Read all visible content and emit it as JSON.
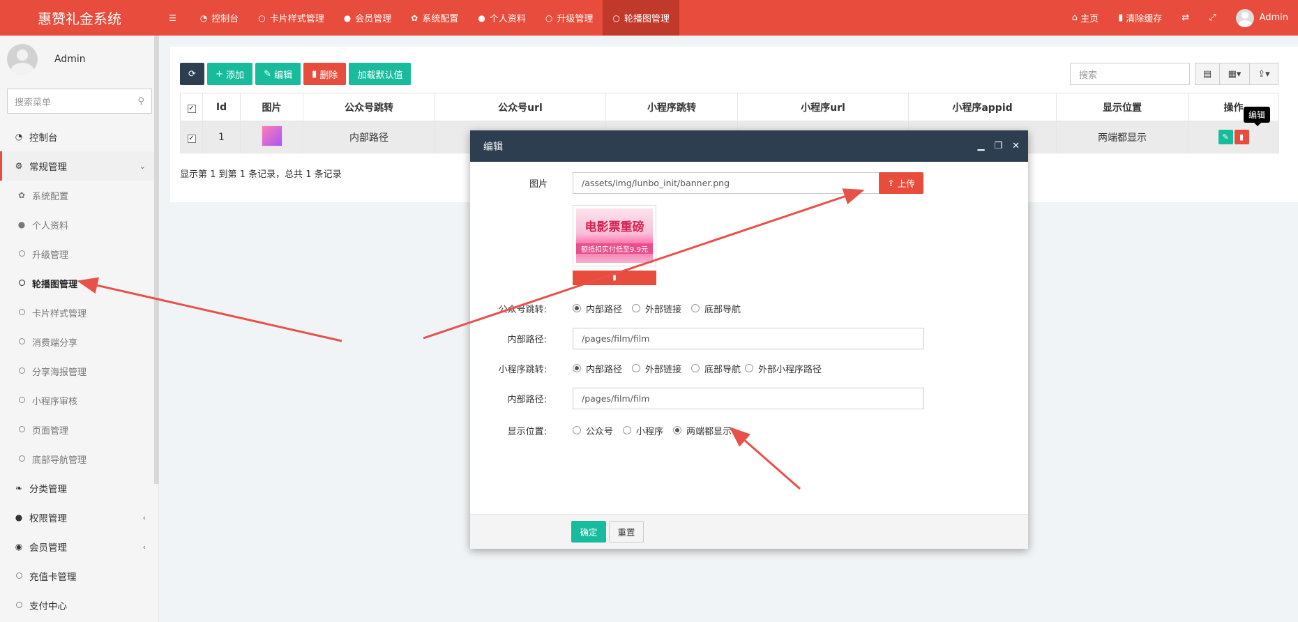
{
  "app": {
    "title": "惠赞礼金系统"
  },
  "topnav": {
    "items": [
      {
        "label": "",
        "icon": "menu-icon"
      },
      {
        "label": "控制台",
        "icon": "dashboard-icon"
      },
      {
        "label": "卡片样式管理",
        "icon": "circle-icon"
      },
      {
        "label": "会员管理",
        "icon": "user-icon"
      },
      {
        "label": "系统配置",
        "icon": "gear-icon"
      },
      {
        "label": "个人资料",
        "icon": "user-icon"
      },
      {
        "label": "升级管理",
        "icon": "circle-icon"
      },
      {
        "label": "轮播图管理",
        "icon": "circle-icon",
        "active": true
      }
    ],
    "right": {
      "home": "主页",
      "clear_cache": "清除缓存",
      "user": "Admin"
    }
  },
  "sidebar": {
    "user": "Admin",
    "search_placeholder": "搜索菜单",
    "items": [
      {
        "label": "控制台",
        "icon": "dashboard-icon",
        "level": 0
      },
      {
        "label": "常规管理",
        "icon": "cogs-icon",
        "level": 0,
        "expanded": true
      },
      {
        "label": "系统配置",
        "icon": "gear-icon",
        "level": 1
      },
      {
        "label": "个人资料",
        "icon": "user-icon",
        "level": 1
      },
      {
        "label": "升级管理",
        "icon": "circle-icon",
        "level": 1
      },
      {
        "label": "轮播图管理",
        "icon": "circle-icon",
        "level": 1,
        "active": true
      },
      {
        "label": "卡片样式管理",
        "icon": "circle-icon",
        "level": 1
      },
      {
        "label": "消费端分享",
        "icon": "circle-icon",
        "level": 1
      },
      {
        "label": "分享海报管理",
        "icon": "circle-icon",
        "level": 1
      },
      {
        "label": "小程序审核",
        "icon": "circle-icon",
        "level": 1
      },
      {
        "label": "页面管理",
        "icon": "circle-icon",
        "level": 1
      },
      {
        "label": "底部导航管理",
        "icon": "circle-icon",
        "level": 1
      },
      {
        "label": "分类管理",
        "icon": "leaf-icon",
        "level": 0
      },
      {
        "label": "权限管理",
        "icon": "group-icon",
        "level": 0,
        "collapsed": true
      },
      {
        "label": "会员管理",
        "icon": "user-circle-icon",
        "level": 0,
        "collapsed": true
      },
      {
        "label": "充值卡管理",
        "icon": "circle-icon",
        "level": 0
      },
      {
        "label": "支付中心",
        "icon": "circle-icon",
        "level": 0
      }
    ]
  },
  "toolbar": {
    "refresh": "",
    "add": "添加",
    "edit": "编辑",
    "delete": "删除",
    "load_default": "加载默认值",
    "search_placeholder": "搜索"
  },
  "table": {
    "columns": [
      "Id",
      "图片",
      "公众号跳转",
      "公众号url",
      "小程序跳转",
      "小程序url",
      "小程序appid",
      "显示位置",
      "操作"
    ],
    "rows": [
      {
        "id": "1",
        "image_text": "电影票",
        "mp_jump": "内部路径",
        "mp_url": "",
        "app_jump": "",
        "app_url": "",
        "appid": "",
        "position": "两端都显示",
        "checked": true
      }
    ],
    "tooltip": "编辑",
    "summary": "显示第 1 到第 1 条记录，总共 1 条记录"
  },
  "modal": {
    "title": "编辑",
    "image_label": "图片",
    "image_value": "/assets/img/lunbo_init/banner.png",
    "upload": "上传",
    "preview_title": "电影票重磅",
    "preview_sub": "额抵扣实付低至9.9元",
    "mp_jump_label": "公众号跳转:",
    "mp_jump_options": [
      "内部路径",
      "外部链接",
      "底部导航"
    ],
    "mp_jump_selected": 0,
    "mp_path_label": "内部路径:",
    "mp_path_value": "/pages/film/film",
    "app_jump_label": "小程序跳转:",
    "app_jump_options": [
      "内部路径",
      "外部链接",
      "底部导航",
      "外部小程序路径"
    ],
    "app_jump_selected": 0,
    "app_path_label": "内部路径:",
    "app_path_value": "/pages/film/film",
    "position_label": "显示位置:",
    "position_options": [
      "公众号",
      "小程序",
      "两端都显示"
    ],
    "position_selected": 2,
    "ok": "确定",
    "reset": "重置"
  },
  "colors": {
    "brand": "#e74c3c",
    "dark": "#2c3e50",
    "success": "#18bc9c",
    "arrow": "#e8504a"
  }
}
